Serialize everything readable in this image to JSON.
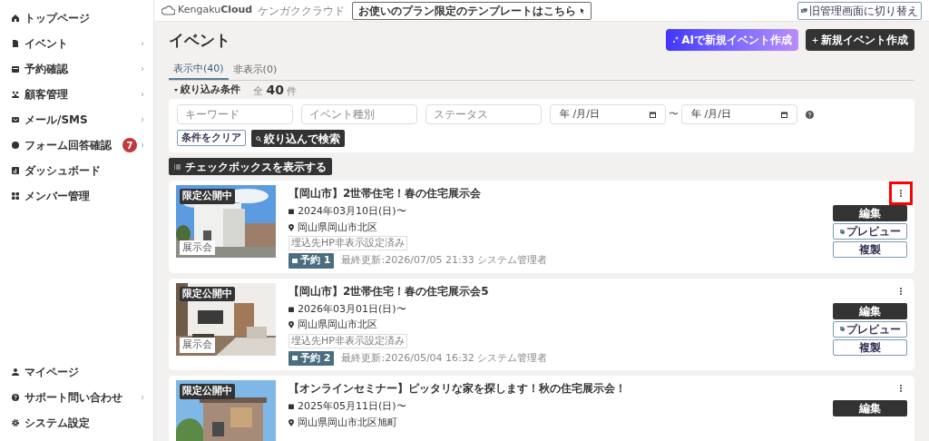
{
  "sidebar": {
    "items": [
      {
        "label": "トップページ",
        "chevron": false
      },
      {
        "label": "イベント",
        "chevron": true
      },
      {
        "label": "予約確認",
        "chevron": true
      },
      {
        "label": "顧客管理",
        "chevron": true
      },
      {
        "label": "メール/SMS",
        "chevron": true
      },
      {
        "label": "フォーム回答確認",
        "badge": "7",
        "chevron": true
      },
      {
        "label": "ダッシュボード",
        "chevron": false
      },
      {
        "label": "メンバー管理",
        "chevron": false
      }
    ],
    "bottom_items": [
      {
        "label": "マイページ",
        "chevron": false
      },
      {
        "label": "サポート問い合わせ",
        "chevron": true
      },
      {
        "label": "システム設定",
        "chevron": false
      }
    ]
  },
  "header": {
    "logo_light": "Kengaku",
    "logo_bold": "Cloud",
    "logo_sub": "ケンガククラウド",
    "template_link": "お使いのプラン限定のテンプレートはこちら",
    "switch_button": "旧管理画面に切り替え"
  },
  "page": {
    "title": "イベント",
    "ai_button": "AIで新規イベント作成",
    "new_button": "新規イベント作成"
  },
  "tabs": [
    {
      "label": "表示中(40)",
      "selected": true
    },
    {
      "label": "非表示(0)",
      "selected": false
    }
  ],
  "filter": {
    "toggle": "絞り込み条件",
    "total_prefix": "全",
    "total": "40",
    "total_suffix": "件",
    "fields": [
      {
        "kind": "text",
        "placeholder": "キーワード"
      },
      {
        "kind": "text",
        "placeholder": "イベント種別"
      },
      {
        "kind": "text",
        "placeholder": "ステータス"
      },
      {
        "kind": "date",
        "placeholder": "年 /月/日"
      },
      {
        "kind": "date",
        "placeholder": "年 /月/日"
      }
    ],
    "range_sep": "〜",
    "clear_button": "条件をクリア",
    "search_button": "絞り込んで検索"
  },
  "checkbox_button": "チェックボックスを表示する",
  "events": [
    {
      "status": "限定公開中",
      "type": "展示会",
      "title": "【岡山市】2世帯住宅！春の住宅展示会",
      "date": "2024年03月10日(日)〜",
      "place": "岡山県岡山市北区",
      "tag": "埋込先HP非表示設定済み",
      "reservations": "予約 1",
      "updated": "最終更新:2026/07/05 21:33 システム管理者",
      "menu_highlighted": true,
      "buttons": [
        "編集",
        "プレビュー",
        "複製"
      ]
    },
    {
      "status": "限定公開中",
      "type": "展示会",
      "title": "【岡山市】2世帯住宅！春の住宅展示会5",
      "date": "2026年03月01日(日)〜",
      "place": "岡山県岡山市北区",
      "tag": "埋込先HP非表示設定済み",
      "reservations": "予約 2",
      "updated": "最終更新:2026/05/04 16:32 システム管理者",
      "menu_highlighted": false,
      "buttons": [
        "編集",
        "プレビュー",
        "複製"
      ]
    },
    {
      "status": "限定公開中",
      "title": "【オンラインセミナー】ピッタリな家を探します！秋の住宅展示会！",
      "date": "2025年05月11日(日)〜",
      "place": "岡山県岡山市北区旭町",
      "menu_highlighted": false,
      "buttons": [
        "編集"
      ]
    }
  ]
}
